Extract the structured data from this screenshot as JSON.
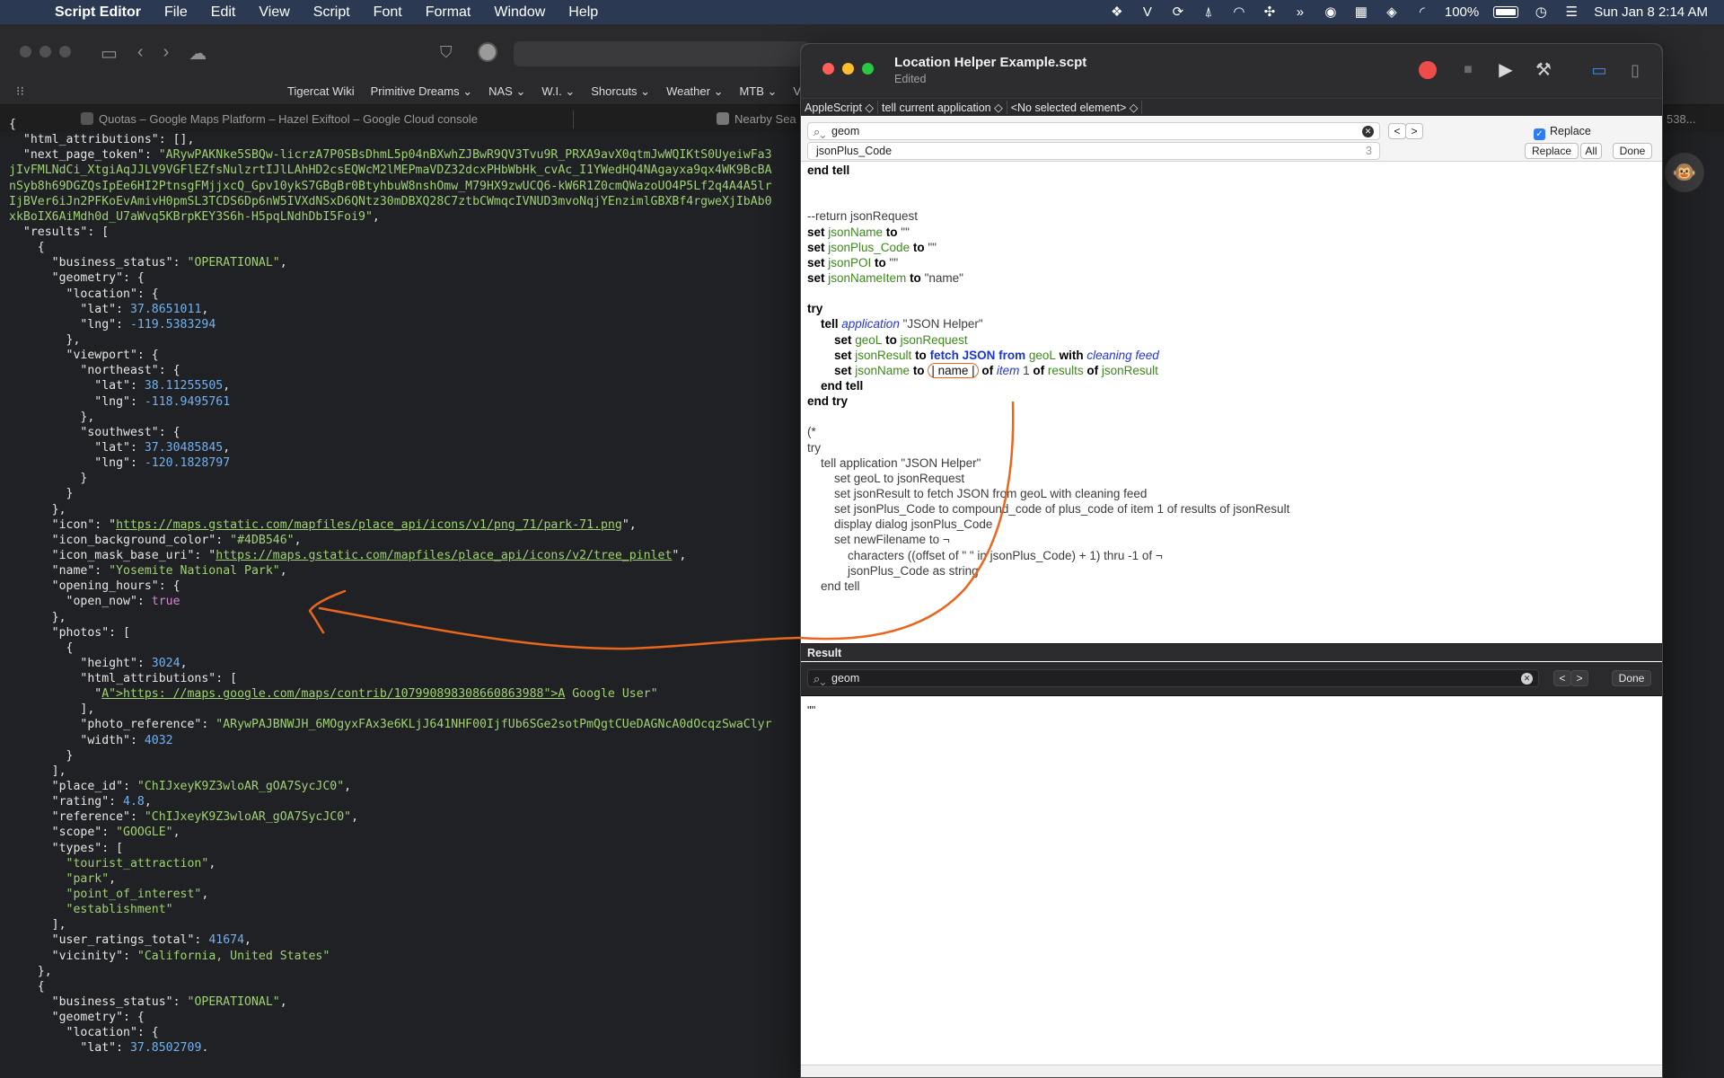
{
  "menubar": {
    "app": "Script Editor",
    "items": [
      "File",
      "Edit",
      "View",
      "Script",
      "Font",
      "Format",
      "Window",
      "Help"
    ],
    "battery": "100%",
    "datetime": "Sun Jan 8  2:14 AM"
  },
  "browser": {
    "bookmarks": [
      "Tigercat Wiki",
      "Primitive Dreams ⌄",
      "NAS ⌄",
      "W.I. ⌄",
      "Shorcuts ⌄",
      "Weather ⌄",
      "MTB ⌄",
      "VP"
    ],
    "tab1": "Quotas – Google Maps Platform – Hazel Exiftool – Google Cloud console",
    "tab2": "Nearby Sea",
    "tabcount": "538..."
  },
  "json_lines": [
    [
      [
        "jk",
        "{"
      ]
    ],
    [
      [
        "jk",
        "  \"html_attributions\": [],"
      ]
    ],
    [
      [
        "jk",
        "  \"next_page_token\": "
      ],
      [
        "js",
        "\"ARywPAKNke5SBQw-licrzA7P0SBsDhmL5p04nBXwhZJBwR9QV3Tvu9R_PRXA9avX0qtmJwWQIKtS0UyeiwFa3"
      ]
    ],
    [
      [
        "js",
        "jIvFMLNdCi_XtgiAqJJLV9VGFlEZfsNulzrtIJlLAhHD2csEQWcM2lMEPmaVDZ32dcxPHbWbHk_cvAc_I1YWedHQ4NAgayxa9qx4WK9BcBA"
      ]
    ],
    [
      [
        "js",
        "nSyb8h69DGZQsIpEe6HI2PtnsgFMjjxcQ_Gpv10ykS7GBgBr0BtyhbuW8nshOmw_M79HX9zwUCQ6-kW6R1Z0cmQWazoUO4P5Lf2q4A4A5lr"
      ]
    ],
    [
      [
        "js",
        "IjBVer6iJn2PFKoEvAmivH0pmSL3TCDS6Dp6nW5IVXdNSxD6QNtz30mDBXQ28C7ztbCWmqcIVNUD3mvoNqjYEnzimlGBXBf4rgweXjIbAb0"
      ]
    ],
    [
      [
        "js",
        "xkBoIX6AiMdh0d_U7aWvq5KBrpKEY3S6h-H5pqLNdhDbI5Foi9\""
      ],
      [
        "jk",
        ","
      ]
    ],
    [
      [
        "jk",
        "  \"results\": ["
      ]
    ],
    [
      [
        "jk",
        "    {"
      ]
    ],
    [
      [
        "jk",
        "      \"business_status\": "
      ],
      [
        "js",
        "\"OPERATIONAL\""
      ],
      [
        "jk",
        ","
      ]
    ],
    [
      [
        "jk",
        "      \"geometry\": {"
      ]
    ],
    [
      [
        "jk",
        "        \"location\": {"
      ]
    ],
    [
      [
        "jk",
        "          \"lat\": "
      ],
      [
        "jn",
        "37.8651011"
      ],
      [
        "jk",
        ","
      ]
    ],
    [
      [
        "jk",
        "          \"lng\": "
      ],
      [
        "jn",
        "-119.5383294"
      ]
    ],
    [
      [
        "jk",
        "        },"
      ]
    ],
    [
      [
        "jk",
        "        \"viewport\": {"
      ]
    ],
    [
      [
        "jk",
        "          \"northeast\": {"
      ]
    ],
    [
      [
        "jk",
        "            \"lat\": "
      ],
      [
        "jn",
        "38.11255505"
      ],
      [
        "jk",
        ","
      ]
    ],
    [
      [
        "jk",
        "            \"lng\": "
      ],
      [
        "jn",
        "-118.9495761"
      ]
    ],
    [
      [
        "jk",
        "          },"
      ]
    ],
    [
      [
        "jk",
        "          \"southwest\": {"
      ]
    ],
    [
      [
        "jk",
        "            \"lat\": "
      ],
      [
        "jn",
        "37.30485845"
      ],
      [
        "jk",
        ","
      ]
    ],
    [
      [
        "jk",
        "            \"lng\": "
      ],
      [
        "jn",
        "-120.1828797"
      ]
    ],
    [
      [
        "jk",
        "          }"
      ]
    ],
    [
      [
        "jk",
        "        }"
      ]
    ],
    [
      [
        "jk",
        "      },"
      ]
    ],
    [
      [
        "jk",
        "      \"icon\": \""
      ],
      [
        "ju",
        "https://maps.gstatic.com/mapfiles/place_api/icons/v1/png_71/park-71.png"
      ],
      [
        "jk",
        "\","
      ]
    ],
    [
      [
        "jk",
        "      \"icon_background_color\": "
      ],
      [
        "js",
        "\"#4DB546\""
      ],
      [
        "jk",
        ","
      ]
    ],
    [
      [
        "jk",
        "      \"icon_mask_base_uri\": \""
      ],
      [
        "ju",
        "https://maps.gstatic.com/mapfiles/place_api/icons/v2/tree_pinlet"
      ],
      [
        "jk",
        "\","
      ]
    ],
    [
      [
        "jk",
        "      \"name\": "
      ],
      [
        "js",
        "\"Yosemite National Park\""
      ],
      [
        "jk",
        ","
      ]
    ],
    [
      [
        "jk",
        "      \"opening_hours\": {"
      ]
    ],
    [
      [
        "jk",
        "        \"open_now\": "
      ],
      [
        "jb",
        "true"
      ]
    ],
    [
      [
        "jk",
        "      },"
      ]
    ],
    [
      [
        "jk",
        "      \"photos\": ["
      ]
    ],
    [
      [
        "jk",
        "        {"
      ]
    ],
    [
      [
        "jk",
        "          \"height\": "
      ],
      [
        "jn",
        "3024"
      ],
      [
        "jk",
        ","
      ]
    ],
    [
      [
        "jk",
        "          \"html_attributions\": ["
      ]
    ],
    [
      [
        "jk",
        "            \""
      ],
      [
        "ju",
        "A\">https: //maps.google.com/maps/contrib/107990898308660863988\">A"
      ],
      [
        "js",
        " Google User\""
      ]
    ],
    [
      [
        "jk",
        "          ],"
      ]
    ],
    [
      [
        "jk",
        "          \"photo_reference\": "
      ],
      [
        "js",
        "\"ARywPAJBNWJH_6MOgyxFAx3e6KLjJ641NHF00IjfUb6SGe2sotPmQgtCUeDAGNcA0dOcqzSwaClyr"
      ]
    ],
    [
      [
        "jk",
        "          \"width\": "
      ],
      [
        "jn",
        "4032"
      ]
    ],
    [
      [
        "jk",
        "        }"
      ]
    ],
    [
      [
        "jk",
        "      ],"
      ]
    ],
    [
      [
        "jk",
        "      \"place_id\": "
      ],
      [
        "js",
        "\"ChIJxeyK9Z3wloAR_gOA7SycJC0\""
      ],
      [
        "jk",
        ","
      ]
    ],
    [
      [
        "jk",
        "      \"rating\": "
      ],
      [
        "jn",
        "4.8"
      ],
      [
        "jk",
        ","
      ]
    ],
    [
      [
        "jk",
        "      \"reference\": "
      ],
      [
        "js",
        "\"ChIJxeyK9Z3wloAR_gOA7SycJC0\""
      ],
      [
        "jk",
        ","
      ]
    ],
    [
      [
        "jk",
        "      \"scope\": "
      ],
      [
        "js",
        "\"GOOGLE\""
      ],
      [
        "jk",
        ","
      ]
    ],
    [
      [
        "jk",
        "      \"types\": ["
      ]
    ],
    [
      [
        "js",
        "        \"tourist_attraction\""
      ],
      [
        "jk",
        ","
      ]
    ],
    [
      [
        "js",
        "        \"park\""
      ],
      [
        "jk",
        ","
      ]
    ],
    [
      [
        "js",
        "        \"point_of_interest\""
      ],
      [
        "jk",
        ","
      ]
    ],
    [
      [
        "js",
        "        \"establishment\""
      ]
    ],
    [
      [
        "jk",
        "      ],"
      ]
    ],
    [
      [
        "jk",
        "      \"user_ratings_total\": "
      ],
      [
        "jn",
        "41674"
      ],
      [
        "jk",
        ","
      ]
    ],
    [
      [
        "jk",
        "      \"vicinity\": "
      ],
      [
        "js",
        "\"California, United States\""
      ]
    ],
    [
      [
        "jk",
        "    },"
      ]
    ],
    [
      [
        "jk",
        "    {"
      ]
    ],
    [
      [
        "jk",
        "      \"business_status\": "
      ],
      [
        "js",
        "\"OPERATIONAL\""
      ],
      [
        "jk",
        ","
      ]
    ],
    [
      [
        "jk",
        "      \"geometry\": {"
      ]
    ],
    [
      [
        "jk",
        "        \"location\": {"
      ]
    ],
    [
      [
        "jk",
        "          \"lat\": "
      ],
      [
        "jn",
        "37.8502709"
      ],
      [
        "jk",
        ","
      ]
    ]
  ],
  "editor": {
    "title": "Location Helper Example.scpt",
    "subtitle": "Edited",
    "navbar": [
      "AppleScript ◇",
      "tell current application ◇",
      "<No selected element> ◇"
    ],
    "find": {
      "search_value": "geom",
      "replace_value": "jsonPlus_Code",
      "replace_count": "3",
      "replace_checkbox": "Replace",
      "prev": "<",
      "next": ">",
      "replace_button": "Replace",
      "all_button": "All",
      "done_button": "Done"
    },
    "script_lines": [
      [
        [
          "kw",
          "end tell"
        ]
      ],
      [],
      [],
      [
        [
          "cm",
          "--return jsonRequest"
        ]
      ],
      [
        [
          "kw",
          "set "
        ],
        [
          "vr",
          "jsonName"
        ],
        [
          "kw",
          " to "
        ],
        [
          "cm",
          "\"\""
        ]
      ],
      [
        [
          "kw",
          "set "
        ],
        [
          "vr",
          "jsonPlus_Code"
        ],
        [
          "kw",
          " to "
        ],
        [
          "cm",
          "\"\""
        ]
      ],
      [
        [
          "kw",
          "set "
        ],
        [
          "vr",
          "jsonPOI"
        ],
        [
          "kw",
          " to "
        ],
        [
          "cm",
          "\"\""
        ]
      ],
      [
        [
          "kw",
          "set "
        ],
        [
          "vr",
          "jsonNameItem"
        ],
        [
          "kw",
          " to "
        ],
        [
          "cm",
          "\"name\""
        ]
      ],
      [],
      [
        [
          "kw",
          "try"
        ]
      ],
      [
        [
          "cm",
          "\t"
        ],
        [
          "kw",
          "tell "
        ],
        [
          "ap",
          "application"
        ],
        [
          "cm",
          " \"JSON Helper\""
        ]
      ],
      [
        [
          "cm",
          "\t\t"
        ],
        [
          "kw",
          "set "
        ],
        [
          "vr",
          "geoL"
        ],
        [
          "kw",
          " to "
        ],
        [
          "vr",
          "jsonRequest"
        ]
      ],
      [
        [
          "cm",
          "\t\t"
        ],
        [
          "kw",
          "set "
        ],
        [
          "vr",
          "jsonResult"
        ],
        [
          "kw",
          " to "
        ],
        [
          "kwb",
          "fetch JSON from "
        ],
        [
          "vr",
          "geoL"
        ],
        [
          "kw",
          " with "
        ],
        [
          "ap",
          "cleaning feed"
        ]
      ],
      [
        [
          "cm",
          "\t\t"
        ],
        [
          "kw",
          "set "
        ],
        [
          "vr",
          "jsonName"
        ],
        [
          "kw",
          " to "
        ],
        [
          "circled",
          "| name |"
        ],
        [
          "kw",
          " of "
        ],
        [
          "ap",
          "item"
        ],
        [
          "cm",
          " 1 "
        ],
        [
          "kw",
          "of "
        ],
        [
          "vr",
          "results"
        ],
        [
          "kw",
          " of "
        ],
        [
          "vr",
          "jsonResult"
        ]
      ],
      [
        [
          "cm",
          "\t"
        ],
        [
          "kw",
          "end tell"
        ]
      ],
      [
        [
          "kw",
          "end try"
        ]
      ],
      [],
      [
        [
          "cm",
          "(*"
        ]
      ],
      [
        [
          "cm",
          "try"
        ]
      ],
      [
        [
          "cm",
          "\ttell application \"JSON Helper\""
        ]
      ],
      [
        [
          "cm",
          "\t\tset geoL to jsonRequest"
        ]
      ],
      [
        [
          "cm",
          "\t\tset jsonResult to fetch JSON from geoL with cleaning feed"
        ]
      ],
      [
        [
          "cm",
          "\t\tset jsonPlus_Code to compound_code of plus_code of item 1 of results of jsonResult"
        ]
      ],
      [
        [
          "cm",
          "\t\tdisplay dialog jsonPlus_Code"
        ]
      ],
      [
        [
          "cm",
          "\t\tset newFilename to ¬"
        ]
      ],
      [
        [
          "cm",
          "\t\t\tcharacters ((offset of \" \" in jsonPlus_Code) + 1) thru -1 of ¬"
        ]
      ],
      [
        [
          "cm",
          "\t\t\tjsonPlus_Code as string"
        ]
      ],
      [
        [
          "cm",
          "\tend tell"
        ]
      ]
    ],
    "result": {
      "header": "Result",
      "search_value": "geom",
      "done_button": "Done",
      "value": "\"\""
    }
  }
}
